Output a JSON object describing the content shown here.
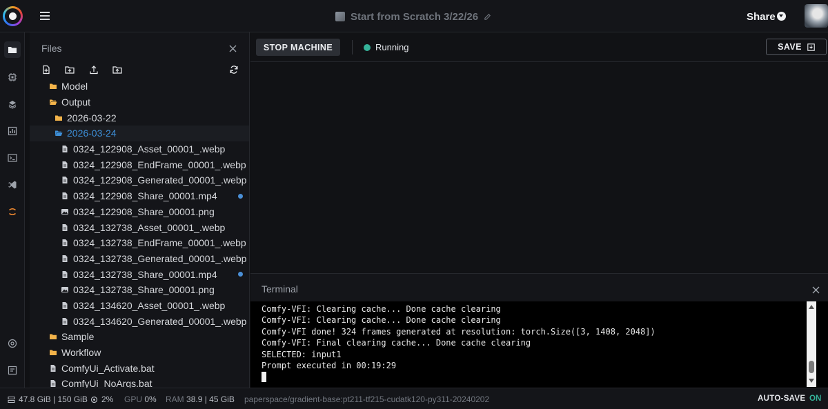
{
  "header": {
    "title": "Start from Scratch 3/22/26",
    "share_label": "Share"
  },
  "files_panel": {
    "title": "Files",
    "tree": [
      {
        "label": "Model",
        "type": "folder",
        "depth": 0
      },
      {
        "label": "Output",
        "type": "folder-open",
        "depth": 0
      },
      {
        "label": "2026-03-22",
        "type": "folder",
        "depth": 1
      },
      {
        "label": "2026-03-24",
        "type": "folder-open",
        "depth": 1,
        "selected": true
      },
      {
        "label": "0324_122908_Asset_00001_.webp",
        "type": "file",
        "depth": 2
      },
      {
        "label": "0324_122908_EndFrame_00001_.webp",
        "type": "file",
        "depth": 2
      },
      {
        "label": "0324_122908_Generated_00001_.webp",
        "type": "file",
        "depth": 2
      },
      {
        "label": "0324_122908_Share_00001.mp4",
        "type": "file",
        "depth": 2,
        "modified": true
      },
      {
        "label": "0324_122908_Share_00001.png",
        "type": "image",
        "depth": 2
      },
      {
        "label": "0324_132738_Asset_00001_.webp",
        "type": "file",
        "depth": 2
      },
      {
        "label": "0324_132738_EndFrame_00001_.webp",
        "type": "file",
        "depth": 2
      },
      {
        "label": "0324_132738_Generated_00001_.webp",
        "type": "file",
        "depth": 2
      },
      {
        "label": "0324_132738_Share_00001.mp4",
        "type": "file",
        "depth": 2,
        "modified": true
      },
      {
        "label": "0324_132738_Share_00001.png",
        "type": "image",
        "depth": 2
      },
      {
        "label": "0324_134620_Asset_00001_.webp",
        "type": "file",
        "depth": 2
      },
      {
        "label": "0324_134620_Generated_00001_.webp",
        "type": "file",
        "depth": 2
      },
      {
        "label": "Sample",
        "type": "folder",
        "depth": 0
      },
      {
        "label": "Workflow",
        "type": "folder",
        "depth": 0
      },
      {
        "label": "ComfyUi_Activate.bat",
        "type": "file",
        "depth": 0
      },
      {
        "label": "ComfyUi_NoArgs.bat",
        "type": "file",
        "depth": 0
      }
    ]
  },
  "toolbar": {
    "stop_label": "STOP MACHINE",
    "status_label": "Running",
    "save_label": "SAVE"
  },
  "terminal": {
    "title": "Terminal",
    "lines": [
      "Comfy-VFI: Clearing cache... Done cache clearing",
      "Comfy-VFI: Clearing cache... Done cache clearing",
      "Comfy-VFI done! 324 frames generated at resolution: torch.Size([3, 1408, 2048])",
      "Comfy-VFI: Final clearing cache... Done cache clearing",
      "SELECTED: input1",
      "Prompt executed in 00:19:29"
    ]
  },
  "statusbar": {
    "storage": "47.8 GiB | 150 GiB",
    "cpu": "2%",
    "gpu_label": "GPU",
    "gpu_value": "0%",
    "ram_label": "RAM",
    "ram_value": "38.9 | 45 GiB",
    "image": "paperspace/gradient-base:pt211-tf215-cudatk120-py311-20240202",
    "autosave_label": "AUTO-SAVE",
    "autosave_state": "ON"
  },
  "colors": {
    "accent_blue": "#3d8fd8",
    "running_green": "#35b39a",
    "folder_yellow": "#f2b34a"
  }
}
